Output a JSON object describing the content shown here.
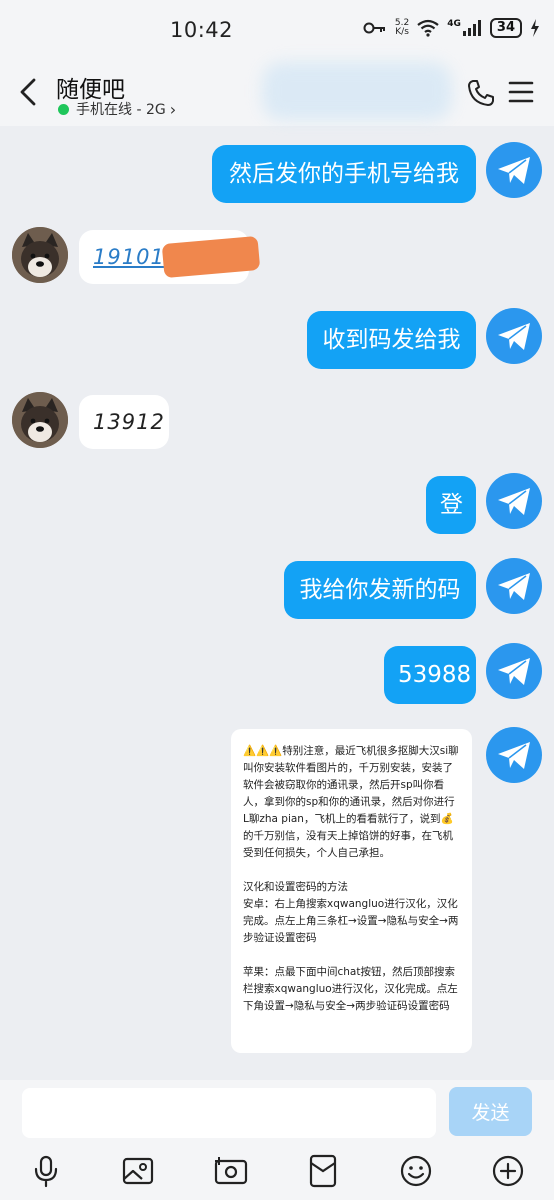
{
  "status_bar": {
    "time": "10:42",
    "net_speed_value": "5.2",
    "net_speed_unit": "K/s",
    "network_type": "4G",
    "battery": "34"
  },
  "header": {
    "title": "随便吧",
    "status": "手机在线 - 2G",
    "status_arrow": "›"
  },
  "messages": {
    "m1": "然后发你的手机号给我",
    "m2": "191015",
    "m3": "收到码发给我",
    "m4": "13912",
    "m5": "登",
    "m6": "我给你发新的码",
    "m7": "53988"
  },
  "notice": {
    "p1": "⚠️⚠️⚠️特别注意，最近飞机很多抠脚大汉si聊叫你安装软件看图片的，千万别安装，安装了软件会被窃取你的通讯录，然后开sp叫你看人，拿到你的sp和你的通讯录，然后对你进行L聊zha pian，飞机上的看看就行了，说到💰的千万别信，没有天上掉馅饼的好事，在飞机受到任何损失，个人自己承担。",
    "p2": "汉化和设置密码的方法\n安卓：右上角搜索xqwangluo进行汉化，汉化完成。点左上角三条杠→设置→隐私与安全→两步验证设置密码",
    "p3": "苹果：点最下面中间chat按钮，然后顶部搜索栏搜索xqwangluo进行汉化，汉化完成。点左下角设置→隐私与安全→两步验证码设置密码"
  },
  "input": {
    "placeholder": "",
    "send_label": "发送"
  },
  "colors": {
    "bubble_out": "#13a2f5",
    "send_disabled": "#a8d4f7",
    "online": "#1fc65b"
  }
}
